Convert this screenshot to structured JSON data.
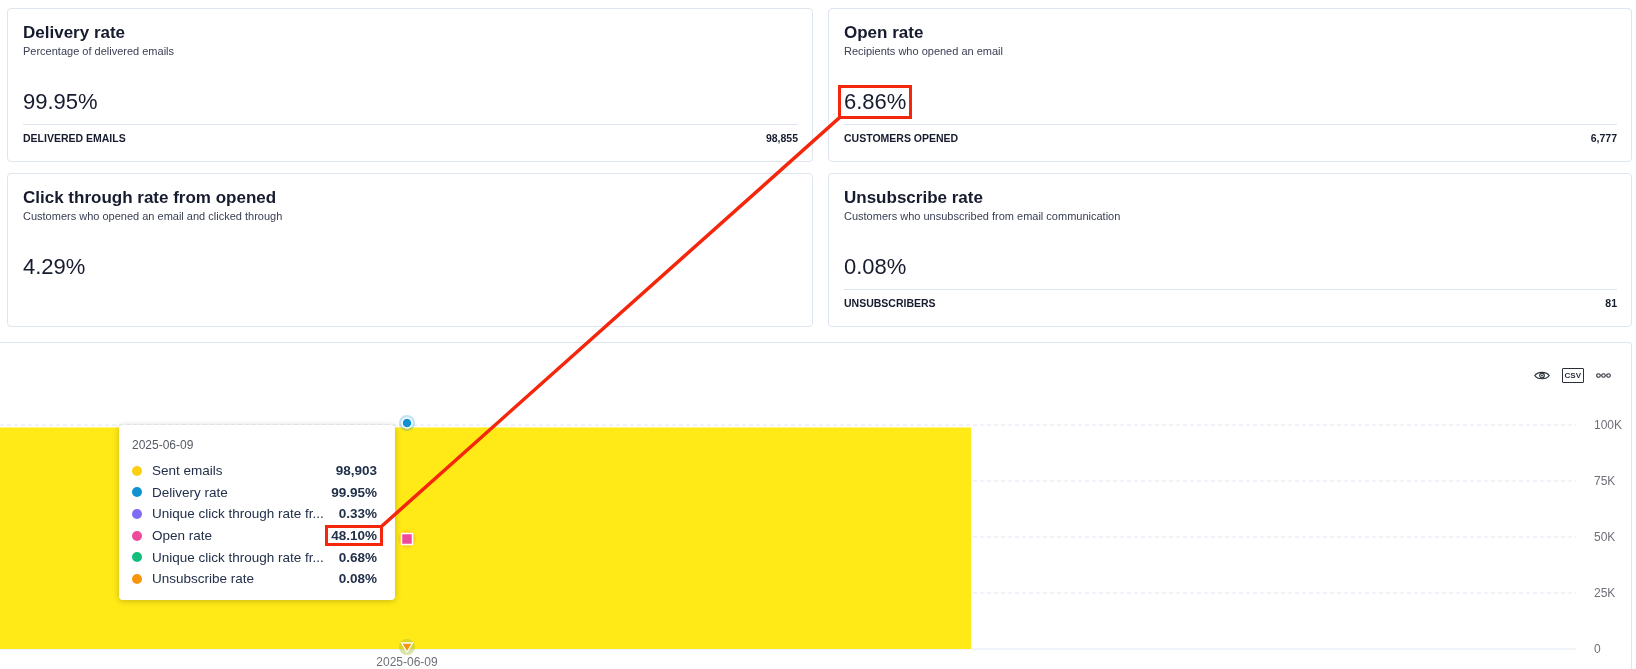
{
  "cards": [
    {
      "title": "Delivery rate",
      "subtitle": "Percentage of delivered emails",
      "value": "99.95%",
      "highlighted": false,
      "footer": {
        "label": "DELIVERED EMAILS",
        "value": "98,855"
      }
    },
    {
      "title": "Open rate",
      "subtitle": "Recipients who opened an email",
      "value": "6.86%",
      "highlighted": true,
      "footer": {
        "label": "CUSTOMERS OPENED",
        "value": "6,777"
      }
    },
    {
      "title": "Click through rate from opened",
      "subtitle": "Customers who opened an email and clicked through",
      "value": "4.29%",
      "highlighted": false
    },
    {
      "title": "Unsubscribe rate",
      "subtitle": "Customers who unsubscribed from email communication",
      "value": "0.08%",
      "highlighted": false,
      "footer": {
        "label": "UNSUBSCRIBERS",
        "value": "81"
      }
    }
  ],
  "chart_panel": {
    "toolbar": [
      {
        "kind": "eye"
      },
      {
        "kind": "csv",
        "label": "CSV"
      },
      {
        "kind": "more"
      }
    ],
    "chart_data": {
      "type": "bar",
      "categories": [
        "2025-06-09"
      ],
      "series": [
        {
          "color": "#ffe916",
          "values": [
            98903
          ]
        }
      ],
      "ylim": [
        0,
        100000
      ],
      "yticks": [
        {
          "value": 0,
          "label": "0"
        },
        {
          "value": 25000,
          "label": "25K"
        },
        {
          "value": 50000,
          "label": "50K"
        },
        {
          "value": 75000,
          "label": "75K"
        },
        {
          "value": 100000,
          "label": "100K"
        }
      ],
      "grid": true
    },
    "tooltip": {
      "title": "2025-06-09",
      "rows": [
        {
          "label": "Sent emails",
          "value": "98,903",
          "color": "#fccf0f",
          "highlighted": false
        },
        {
          "label": "Delivery rate",
          "value": "99.95%",
          "color": "#1190d2",
          "highlighted": false
        },
        {
          "label": "Unique click through rate fr...",
          "value": "0.33%",
          "color": "#7d6cf7",
          "highlighted": false
        },
        {
          "label": "Open rate",
          "value": "48.10%",
          "color": "#ee4a9c",
          "highlighted": true
        },
        {
          "label": "Unique click through rate fr...",
          "value": "0.68%",
          "color": "#13bd7c",
          "highlighted": false
        },
        {
          "label": "Unsubscribe rate",
          "value": "0.08%",
          "color": "#f7940e",
          "highlighted": false
        }
      ]
    }
  },
  "callout_line": true
}
